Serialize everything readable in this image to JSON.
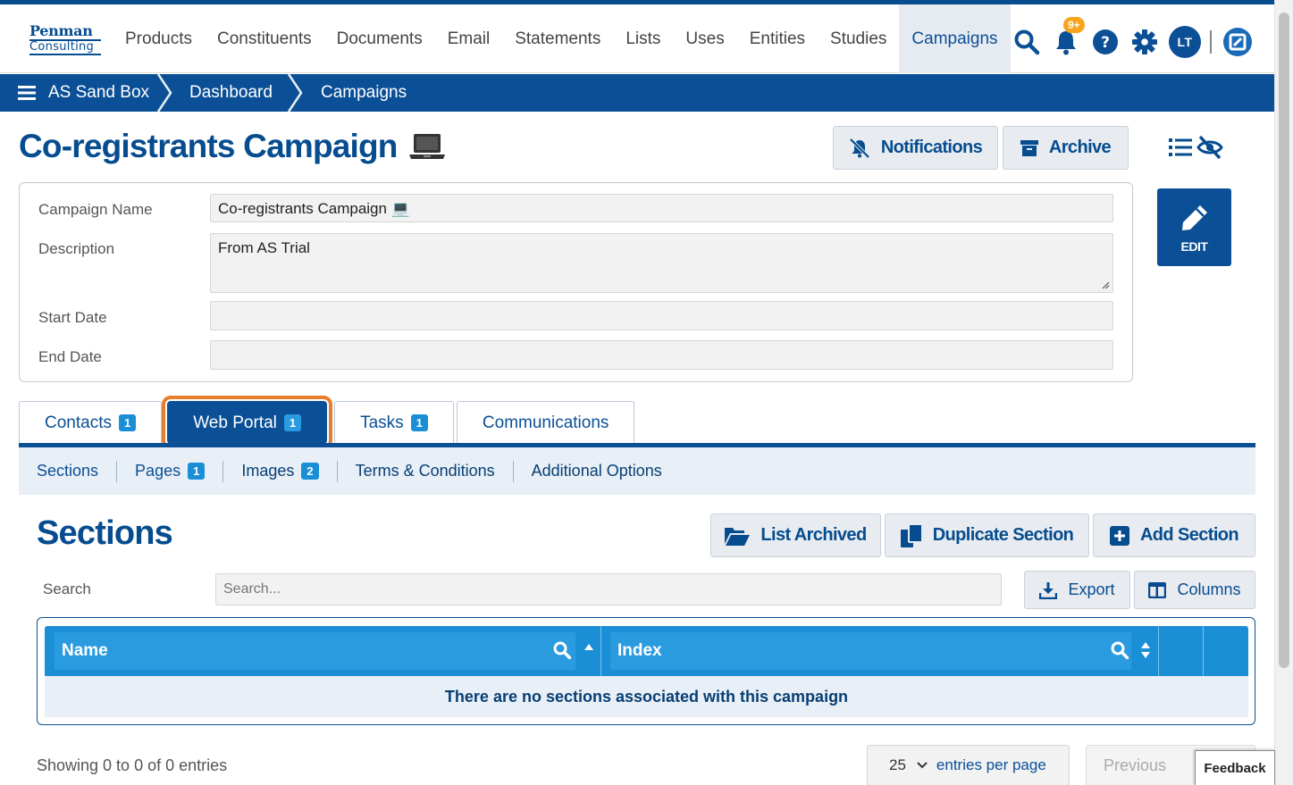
{
  "logo": {
    "line1": "Penman",
    "line2": "Consulting"
  },
  "nav": {
    "items": [
      "Products",
      "Constituents",
      "Documents",
      "Email",
      "Statements",
      "Lists",
      "Uses",
      "Entities",
      "Studies",
      "Campaigns"
    ],
    "active": "Campaigns"
  },
  "header_icons": {
    "notification_count": "9+",
    "user_initials": "LT",
    "icons": [
      "search-icon",
      "bell-icon",
      "help-icon",
      "gear-icon",
      "avatar",
      "app-switch-icon"
    ]
  },
  "breadcrumbs": [
    "AS Sand Box",
    "Dashboard",
    "Campaigns"
  ],
  "page": {
    "title": "Co-registrants Campaign",
    "title_emoji": "💻",
    "buttons": {
      "notifications": "Notifications",
      "archive": "Archive",
      "edit": "EDIT"
    }
  },
  "form": {
    "fields": [
      {
        "label": "Campaign Name",
        "value": "Co-registrants Campaign 💻"
      },
      {
        "label": "Description",
        "value": "From AS Trial"
      },
      {
        "label": "Start Date",
        "value": ""
      },
      {
        "label": "End Date",
        "value": ""
      }
    ]
  },
  "tabs": [
    {
      "label": "Contacts",
      "badge": "1"
    },
    {
      "label": "Web Portal",
      "badge": "1",
      "active": true
    },
    {
      "label": "Tasks",
      "badge": "1"
    },
    {
      "label": "Communications",
      "badge": ""
    }
  ],
  "subnav": [
    {
      "label": "Sections",
      "badge": ""
    },
    {
      "label": "Pages",
      "badge": "1"
    },
    {
      "label": "Images",
      "badge": "2"
    },
    {
      "label": "Terms & Conditions",
      "badge": ""
    },
    {
      "label": "Additional Options",
      "badge": ""
    }
  ],
  "sections": {
    "title": "Sections",
    "buttons": {
      "list_archived": "List Archived",
      "duplicate": "Duplicate Section",
      "add": "Add Section"
    },
    "search_label": "Search",
    "search_placeholder": "Search...",
    "export": "Export",
    "columns": "Columns",
    "table": {
      "headers": [
        "Name",
        "Index"
      ],
      "empty_message": "There are no sections associated with this campaign"
    },
    "showing": "Showing 0 to 0 of 0 entries",
    "per_page_value": "25",
    "per_page_label": "entries per page",
    "previous": "Previous"
  },
  "feedback": "Feedback",
  "colors": {
    "brand": "#0b4f96",
    "accent_badge": "#f7a51b",
    "highlight": "#e87d2c",
    "header_cell": "#1a8fd6"
  }
}
